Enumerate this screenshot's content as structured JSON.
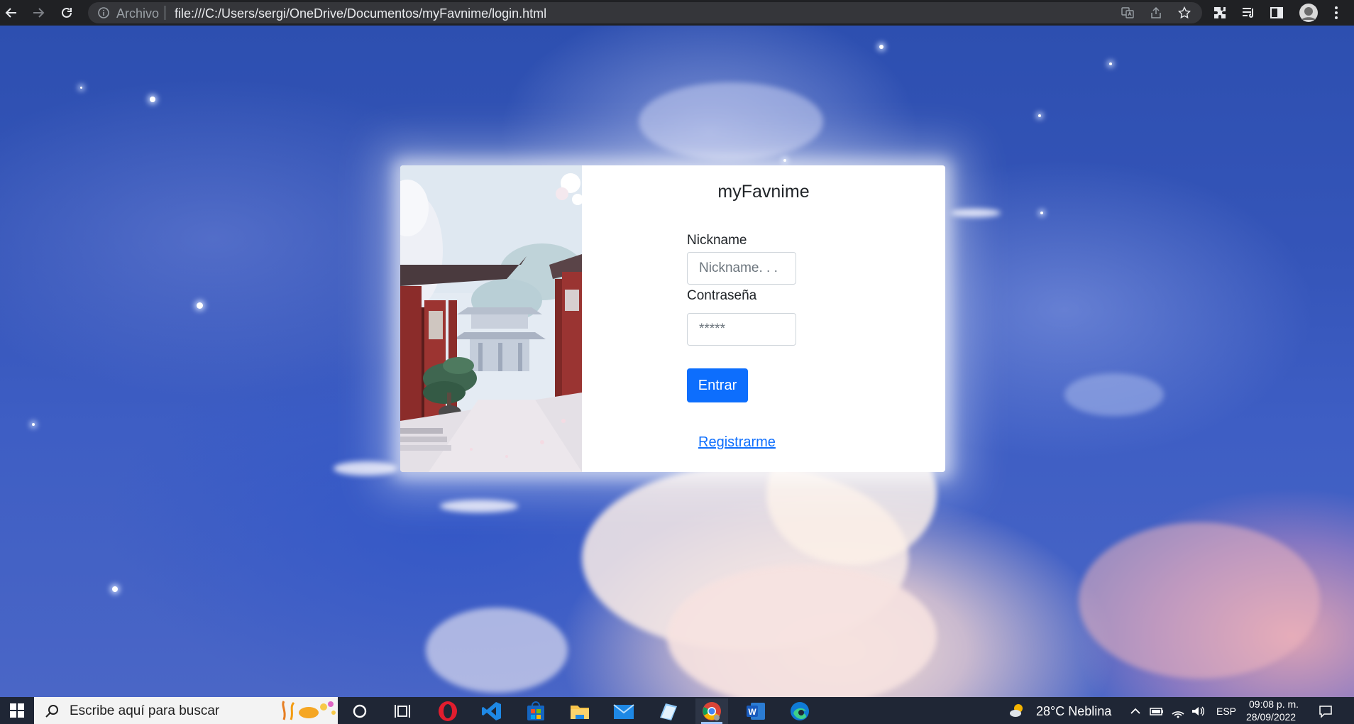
{
  "browser": {
    "scheme_label": "Archivo",
    "url": "file:///C:/Users/sergi/OneDrive/Documentos/myFavnime/login.html",
    "icons": [
      "back-icon",
      "forward-icon",
      "reload-icon",
      "info-icon",
      "translate-icon",
      "share-icon",
      "bookmark-star-icon",
      "extensions-icon",
      "reading-list-icon",
      "side-panel-icon",
      "profile-avatar-icon",
      "menu-icon"
    ]
  },
  "login": {
    "title": "myFavnime",
    "nickname_label": "Nickname",
    "nickname_placeholder": "Nickname. . .",
    "password_label": "Contraseña",
    "password_placeholder": "*****",
    "submit_label": "Entrar",
    "register_link": "Registrarme"
  },
  "taskbar": {
    "search_placeholder": "Escribe aquí para buscar",
    "apps": [
      "cortana",
      "task-view",
      "opera",
      "vscode",
      "microsoft-store",
      "file-explorer",
      "mail",
      "notes",
      "chrome",
      "word",
      "edge"
    ],
    "weather": "28°C  Neblina",
    "language": "ESP",
    "time": "09:08 p. m.",
    "date": "28/09/2022"
  },
  "colors": {
    "primary": "#0d6efd",
    "browser_bar": "#202124",
    "taskbar": "#1f2635"
  }
}
